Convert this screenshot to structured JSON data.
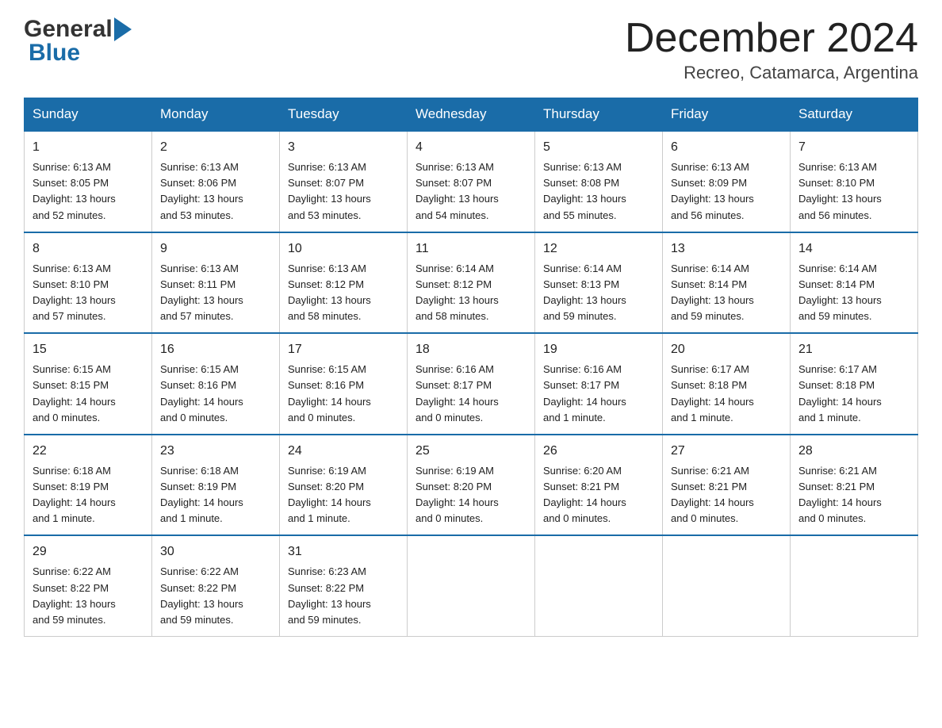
{
  "header": {
    "logo_general": "General",
    "logo_blue": "Blue",
    "month_title": "December 2024",
    "subtitle": "Recreo, Catamarca, Argentina"
  },
  "days_header": [
    "Sunday",
    "Monday",
    "Tuesday",
    "Wednesday",
    "Thursday",
    "Friday",
    "Saturday"
  ],
  "weeks": [
    [
      {
        "num": "1",
        "sunrise": "6:13 AM",
        "sunset": "8:05 PM",
        "daylight": "13 hours and 52 minutes."
      },
      {
        "num": "2",
        "sunrise": "6:13 AM",
        "sunset": "8:06 PM",
        "daylight": "13 hours and 53 minutes."
      },
      {
        "num": "3",
        "sunrise": "6:13 AM",
        "sunset": "8:07 PM",
        "daylight": "13 hours and 53 minutes."
      },
      {
        "num": "4",
        "sunrise": "6:13 AM",
        "sunset": "8:07 PM",
        "daylight": "13 hours and 54 minutes."
      },
      {
        "num": "5",
        "sunrise": "6:13 AM",
        "sunset": "8:08 PM",
        "daylight": "13 hours and 55 minutes."
      },
      {
        "num": "6",
        "sunrise": "6:13 AM",
        "sunset": "8:09 PM",
        "daylight": "13 hours and 56 minutes."
      },
      {
        "num": "7",
        "sunrise": "6:13 AM",
        "sunset": "8:10 PM",
        "daylight": "13 hours and 56 minutes."
      }
    ],
    [
      {
        "num": "8",
        "sunrise": "6:13 AM",
        "sunset": "8:10 PM",
        "daylight": "13 hours and 57 minutes."
      },
      {
        "num": "9",
        "sunrise": "6:13 AM",
        "sunset": "8:11 PM",
        "daylight": "13 hours and 57 minutes."
      },
      {
        "num": "10",
        "sunrise": "6:13 AM",
        "sunset": "8:12 PM",
        "daylight": "13 hours and 58 minutes."
      },
      {
        "num": "11",
        "sunrise": "6:14 AM",
        "sunset": "8:12 PM",
        "daylight": "13 hours and 58 minutes."
      },
      {
        "num": "12",
        "sunrise": "6:14 AM",
        "sunset": "8:13 PM",
        "daylight": "13 hours and 59 minutes."
      },
      {
        "num": "13",
        "sunrise": "6:14 AM",
        "sunset": "8:14 PM",
        "daylight": "13 hours and 59 minutes."
      },
      {
        "num": "14",
        "sunrise": "6:14 AM",
        "sunset": "8:14 PM",
        "daylight": "13 hours and 59 minutes."
      }
    ],
    [
      {
        "num": "15",
        "sunrise": "6:15 AM",
        "sunset": "8:15 PM",
        "daylight": "14 hours and 0 minutes."
      },
      {
        "num": "16",
        "sunrise": "6:15 AM",
        "sunset": "8:16 PM",
        "daylight": "14 hours and 0 minutes."
      },
      {
        "num": "17",
        "sunrise": "6:15 AM",
        "sunset": "8:16 PM",
        "daylight": "14 hours and 0 minutes."
      },
      {
        "num": "18",
        "sunrise": "6:16 AM",
        "sunset": "8:17 PM",
        "daylight": "14 hours and 0 minutes."
      },
      {
        "num": "19",
        "sunrise": "6:16 AM",
        "sunset": "8:17 PM",
        "daylight": "14 hours and 1 minute."
      },
      {
        "num": "20",
        "sunrise": "6:17 AM",
        "sunset": "8:18 PM",
        "daylight": "14 hours and 1 minute."
      },
      {
        "num": "21",
        "sunrise": "6:17 AM",
        "sunset": "8:18 PM",
        "daylight": "14 hours and 1 minute."
      }
    ],
    [
      {
        "num": "22",
        "sunrise": "6:18 AM",
        "sunset": "8:19 PM",
        "daylight": "14 hours and 1 minute."
      },
      {
        "num": "23",
        "sunrise": "6:18 AM",
        "sunset": "8:19 PM",
        "daylight": "14 hours and 1 minute."
      },
      {
        "num": "24",
        "sunrise": "6:19 AM",
        "sunset": "8:20 PM",
        "daylight": "14 hours and 1 minute."
      },
      {
        "num": "25",
        "sunrise": "6:19 AM",
        "sunset": "8:20 PM",
        "daylight": "14 hours and 0 minutes."
      },
      {
        "num": "26",
        "sunrise": "6:20 AM",
        "sunset": "8:21 PM",
        "daylight": "14 hours and 0 minutes."
      },
      {
        "num": "27",
        "sunrise": "6:21 AM",
        "sunset": "8:21 PM",
        "daylight": "14 hours and 0 minutes."
      },
      {
        "num": "28",
        "sunrise": "6:21 AM",
        "sunset": "8:21 PM",
        "daylight": "14 hours and 0 minutes."
      }
    ],
    [
      {
        "num": "29",
        "sunrise": "6:22 AM",
        "sunset": "8:22 PM",
        "daylight": "13 hours and 59 minutes."
      },
      {
        "num": "30",
        "sunrise": "6:22 AM",
        "sunset": "8:22 PM",
        "daylight": "13 hours and 59 minutes."
      },
      {
        "num": "31",
        "sunrise": "6:23 AM",
        "sunset": "8:22 PM",
        "daylight": "13 hours and 59 minutes."
      },
      null,
      null,
      null,
      null
    ]
  ],
  "labels": {
    "sunrise": "Sunrise:",
    "sunset": "Sunset:",
    "daylight": "Daylight:"
  },
  "colors": {
    "header_bg": "#1a6ca8",
    "header_text": "#ffffff",
    "border": "#1a6ca8"
  }
}
